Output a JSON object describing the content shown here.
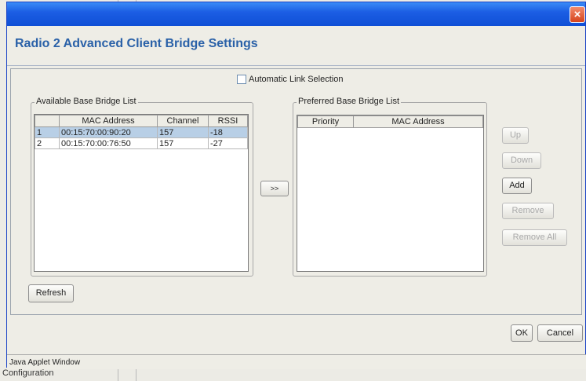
{
  "window": {
    "close_icon": "×"
  },
  "header": {
    "title": "Radio 2 Advanced Client Bridge Settings"
  },
  "auto_link": {
    "label": "Automatic Link Selection",
    "checked": false
  },
  "available": {
    "title": "Available Base Bridge List",
    "columns": [
      "",
      "MAC Address",
      "Channel",
      "RSSI"
    ],
    "rows": [
      {
        "num": "1",
        "mac": "00:15:70:00:90:20",
        "channel": "157",
        "rssi": "-18",
        "selected": true
      },
      {
        "num": "2",
        "mac": "00:15:70:00:76:50",
        "channel": "157",
        "rssi": "-27",
        "selected": false
      }
    ]
  },
  "transfer_button": {
    "label": ">>"
  },
  "preferred": {
    "title": "Preferred Base Bridge List",
    "columns": [
      "Priority",
      "MAC Address"
    ]
  },
  "buttons": {
    "up": "Up",
    "down": "Down",
    "add": "Add",
    "remove": "Remove",
    "remove_all": "Remove All",
    "refresh": "Refresh",
    "ok": "OK",
    "cancel": "Cancel"
  },
  "status_bar": {
    "text": "Java Applet Window"
  },
  "background": {
    "text": "Configuration"
  },
  "colors": {
    "title_bar": "#1c5ee4",
    "header_text": "#2a61a8",
    "selection": "#b8cfe6"
  }
}
